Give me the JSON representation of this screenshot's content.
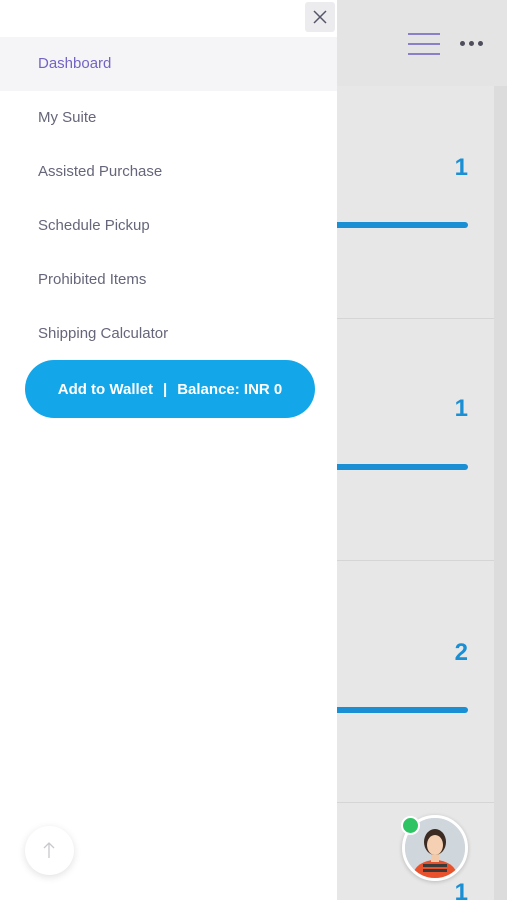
{
  "drawer": {
    "menu": [
      {
        "label": "Dashboard",
        "active": true
      },
      {
        "label": "My Suite",
        "active": false
      },
      {
        "label": "Assisted Purchase",
        "active": false
      },
      {
        "label": "Schedule Pickup",
        "active": false
      },
      {
        "label": "Prohibited Items",
        "active": false
      },
      {
        "label": "Shipping Calculator",
        "active": false
      }
    ],
    "wallet": {
      "add_label": "Add to Wallet",
      "separator": "|",
      "balance_label": "Balance: INR 0"
    }
  },
  "background": {
    "cards": [
      {
        "value": "1"
      },
      {
        "value": "1"
      },
      {
        "value": "2"
      },
      {
        "value": "1"
      }
    ]
  },
  "icons": {
    "close": "close-icon",
    "menu": "hamburger-menu-icon",
    "more": "more-dots-icon",
    "scroll_top": "arrow-up-icon",
    "avatar": "user-avatar"
  },
  "colors": {
    "accent_blue": "#13a7ea",
    "stat_blue": "#1a8fd4",
    "active_purple": "#7563c4",
    "online_green": "#2ec464"
  }
}
